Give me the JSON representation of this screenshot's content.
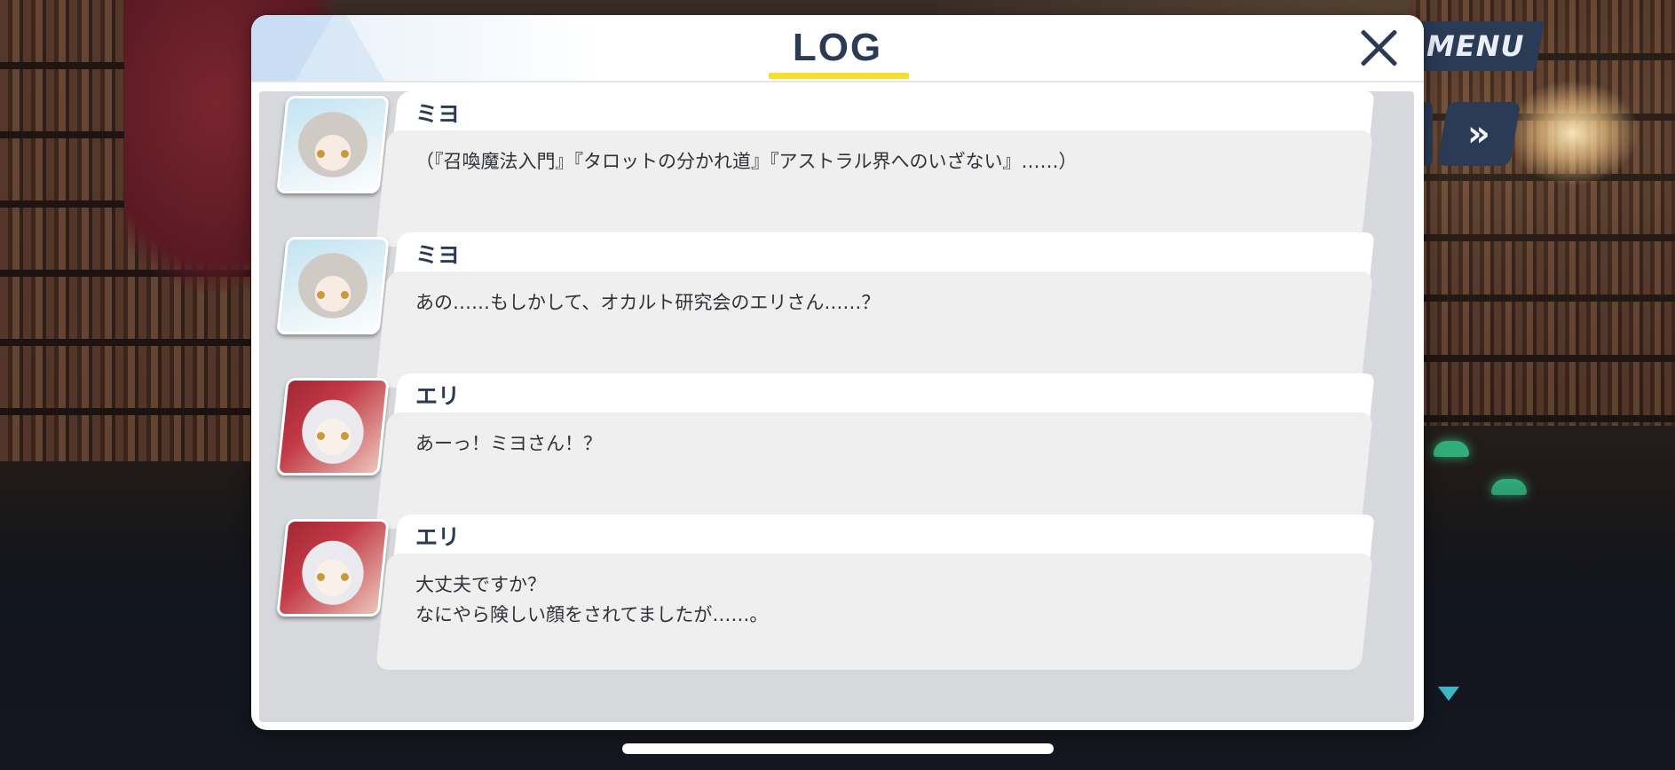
{
  "hud": {
    "menu_label": "MENU",
    "fast_forward_icon": "fast-forward-icon"
  },
  "log_panel": {
    "title": "LOG",
    "close_icon": "close-icon",
    "entries": [
      {
        "speaker": "ミヨ",
        "text": "（『召喚魔法入門』『タロットの分かれ道』『アストラル界へのいざない』……）",
        "avatar": "miyo-avatar"
      },
      {
        "speaker": "ミヨ",
        "text": "あの……もしかして、オカルト研究会のエリさん……？",
        "avatar": "miyo-avatar"
      },
      {
        "speaker": "エリ",
        "text": "あーっ！ミヨさん！？",
        "avatar": "eri-avatar"
      },
      {
        "speaker": "エリ",
        "text": "大丈夫ですか？\nなにやら険しい顔をされてましたが……。",
        "avatar": "eri-avatar"
      }
    ]
  },
  "colors": {
    "accent_navy": "#2b3a55",
    "title_underline": "#f4e02c",
    "bubble_bg": "#efefef",
    "log_bg": "#d7d8db"
  }
}
